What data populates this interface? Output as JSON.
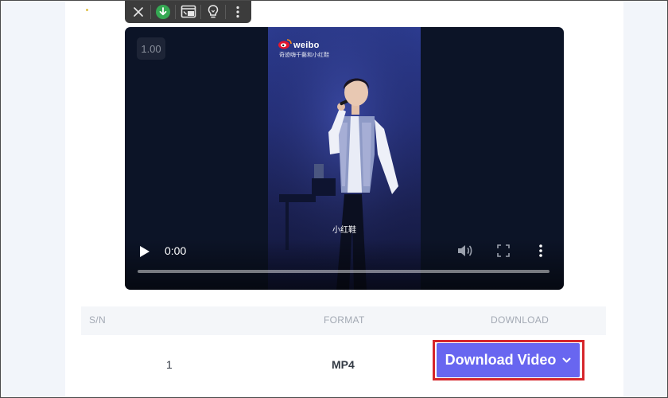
{
  "toolbar": {
    "icons": [
      "close-icon",
      "download-icon",
      "picture-in-picture-icon",
      "lightbulb-icon",
      "more-vertical-icon"
    ],
    "download_color": "#35a853"
  },
  "player": {
    "speed": "1.00",
    "time": "0:00",
    "progress": 0,
    "watermark": {
      "brand": "weibo",
      "line": "奇迹嗨千藝和小红鞋"
    },
    "subtitle": "小红鞋",
    "icons": [
      "play-icon",
      "volume-icon",
      "fullscreen-icon",
      "more-vertical-icon"
    ]
  },
  "table": {
    "headers": {
      "sn": "S/N",
      "format": "FORMAT",
      "download": "DOWNLOAD"
    },
    "rows": [
      {
        "sn": "1",
        "format": "MP4",
        "action": "Download Video"
      }
    ]
  },
  "colors": {
    "accent": "#6866f0",
    "highlight": "#d6262b"
  }
}
